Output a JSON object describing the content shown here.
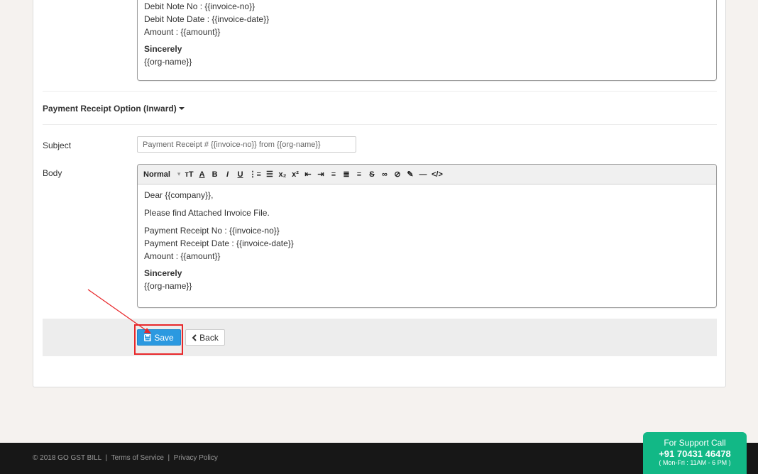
{
  "debit_note_editor": {
    "lines": [
      "Debit Note No : {{invoice-no}}",
      "Debit Note Date : {{invoice-date}}",
      "Amount : {{amount}}"
    ],
    "signoff": "Sincerely",
    "org": "{{org-name}}"
  },
  "payment_section": {
    "title": "Payment Receipt Option (Inward)",
    "subject_label": "Subject",
    "subject_value": "Payment Receipt # {{invoice-no}} from {{org-name}}",
    "body_label": "Body"
  },
  "toolbar": {
    "format": "Normal",
    "buttons": [
      {
        "name": "font-size-icon",
        "glyph": "тT"
      },
      {
        "name": "font-color-icon",
        "glyph": "A"
      },
      {
        "name": "bold-icon",
        "glyph": "B"
      },
      {
        "name": "italic-icon",
        "glyph": "I"
      },
      {
        "name": "underline-icon",
        "glyph": "U"
      },
      {
        "name": "ordered-list-icon",
        "glyph": "⋮≡"
      },
      {
        "name": "bullet-list-icon",
        "glyph": "☰"
      },
      {
        "name": "subscript-icon",
        "glyph": "x₂"
      },
      {
        "name": "superscript-icon",
        "glyph": "x²"
      },
      {
        "name": "indent-left-icon",
        "glyph": "⇤"
      },
      {
        "name": "indent-right-icon",
        "glyph": "⇥"
      },
      {
        "name": "align-left-icon",
        "glyph": "≡"
      },
      {
        "name": "align-center-icon",
        "glyph": "≣"
      },
      {
        "name": "align-right-icon",
        "glyph": "≡"
      },
      {
        "name": "strikethrough-icon",
        "glyph": "S"
      },
      {
        "name": "link-icon",
        "glyph": "∞"
      },
      {
        "name": "unlink-icon",
        "glyph": "⊘"
      },
      {
        "name": "clear-format-icon",
        "glyph": "✎"
      },
      {
        "name": "horizontal-rule-icon",
        "glyph": "—"
      },
      {
        "name": "source-code-icon",
        "glyph": "</>"
      }
    ]
  },
  "payment_editor": {
    "greeting": "Dear {{company}},",
    "intro": "Please find Attached Invoice File.",
    "lines": [
      "Payment Receipt No : {{invoice-no}}",
      "Payment Receipt Date : {{invoice-date}}",
      "Amount : {{amount}}"
    ],
    "signoff": "Sincerely",
    "org": "{{org-name}}"
  },
  "actions": {
    "save_label": "Save",
    "back_label": "Back"
  },
  "footer": {
    "copyright": "© 2018 GO GST BILL",
    "terms": "Terms of Service",
    "privacy": "Privacy Policy",
    "separator": "|"
  },
  "support": {
    "line1": "For Support Call",
    "phone": "+91 70431 46478",
    "hours": "( Mon-Fri : 11AM - 6 PM )"
  },
  "colors": {
    "save_button": "#2b99e0",
    "highlight": "#e8272a",
    "support_badge": "#12b886",
    "footer_bg": "#171717"
  }
}
